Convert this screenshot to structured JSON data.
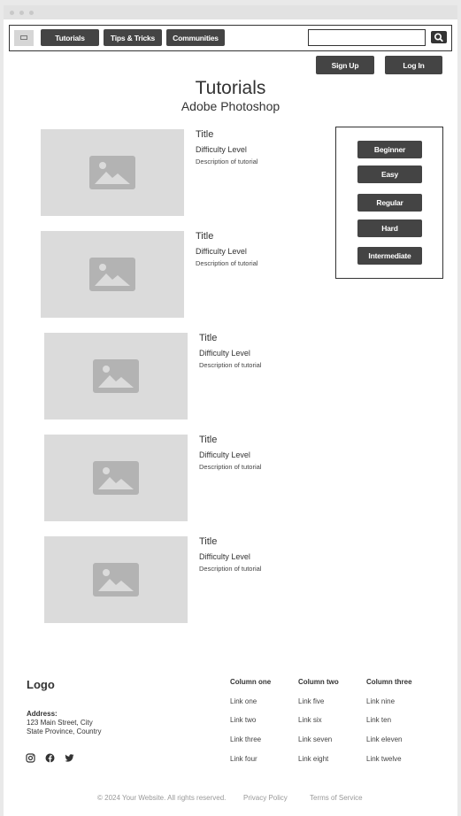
{
  "nav": {
    "items": [
      {
        "label": "Tutorials"
      },
      {
        "label": "Tips & Tricks"
      },
      {
        "label": "Communities"
      }
    ],
    "search_value": ""
  },
  "auth": {
    "signup_label": "Sign Up",
    "login_label": "Log In"
  },
  "hero": {
    "title": "Tutorials",
    "subtitle": "Adobe Photoshop"
  },
  "tutorials": [
    {
      "title": "Title",
      "difficulty": "Difficulty Level",
      "description": "Description of tutorial"
    },
    {
      "title": "Title",
      "difficulty": "Difficulty Level",
      "description": "Description of tutorial"
    },
    {
      "title": "Title",
      "difficulty": "Difficulty Level",
      "description": "Description of tutorial"
    },
    {
      "title": "Title",
      "difficulty": "Difficulty Level",
      "description": "Description of tutorial"
    },
    {
      "title": "Title",
      "difficulty": "Difficulty Level",
      "description": "Description of tutorial"
    }
  ],
  "filters": [
    "Beginner",
    "Easy",
    "Regular",
    "Hard",
    "Intermediate"
  ],
  "footer": {
    "logo": "Logo",
    "address_label": "Address:",
    "address_line1": "123 Main Street, City",
    "address_line2": "State Province, Country",
    "social_icons": [
      "instagram-icon",
      "facebook-icon",
      "twitter-icon"
    ],
    "columns": [
      {
        "heading": "Column one",
        "links": [
          "Link one",
          "Link two",
          "Link three",
          "Link four"
        ]
      },
      {
        "heading": "Column two",
        "links": [
          "Link five",
          "Link six",
          "Link seven",
          "Link eight"
        ]
      },
      {
        "heading": "Column three",
        "links": [
          "Link nine",
          "Link ten",
          "Link eleven",
          "Link twelve"
        ]
      }
    ],
    "copyright": "© 2024 Your Website. All rights reserved.",
    "privacy": "Privacy Policy",
    "terms": "Terms of Service"
  },
  "colors": {
    "button": "#444444",
    "placeholder": "#dbdbdb",
    "icon": "#b3b3b3"
  }
}
